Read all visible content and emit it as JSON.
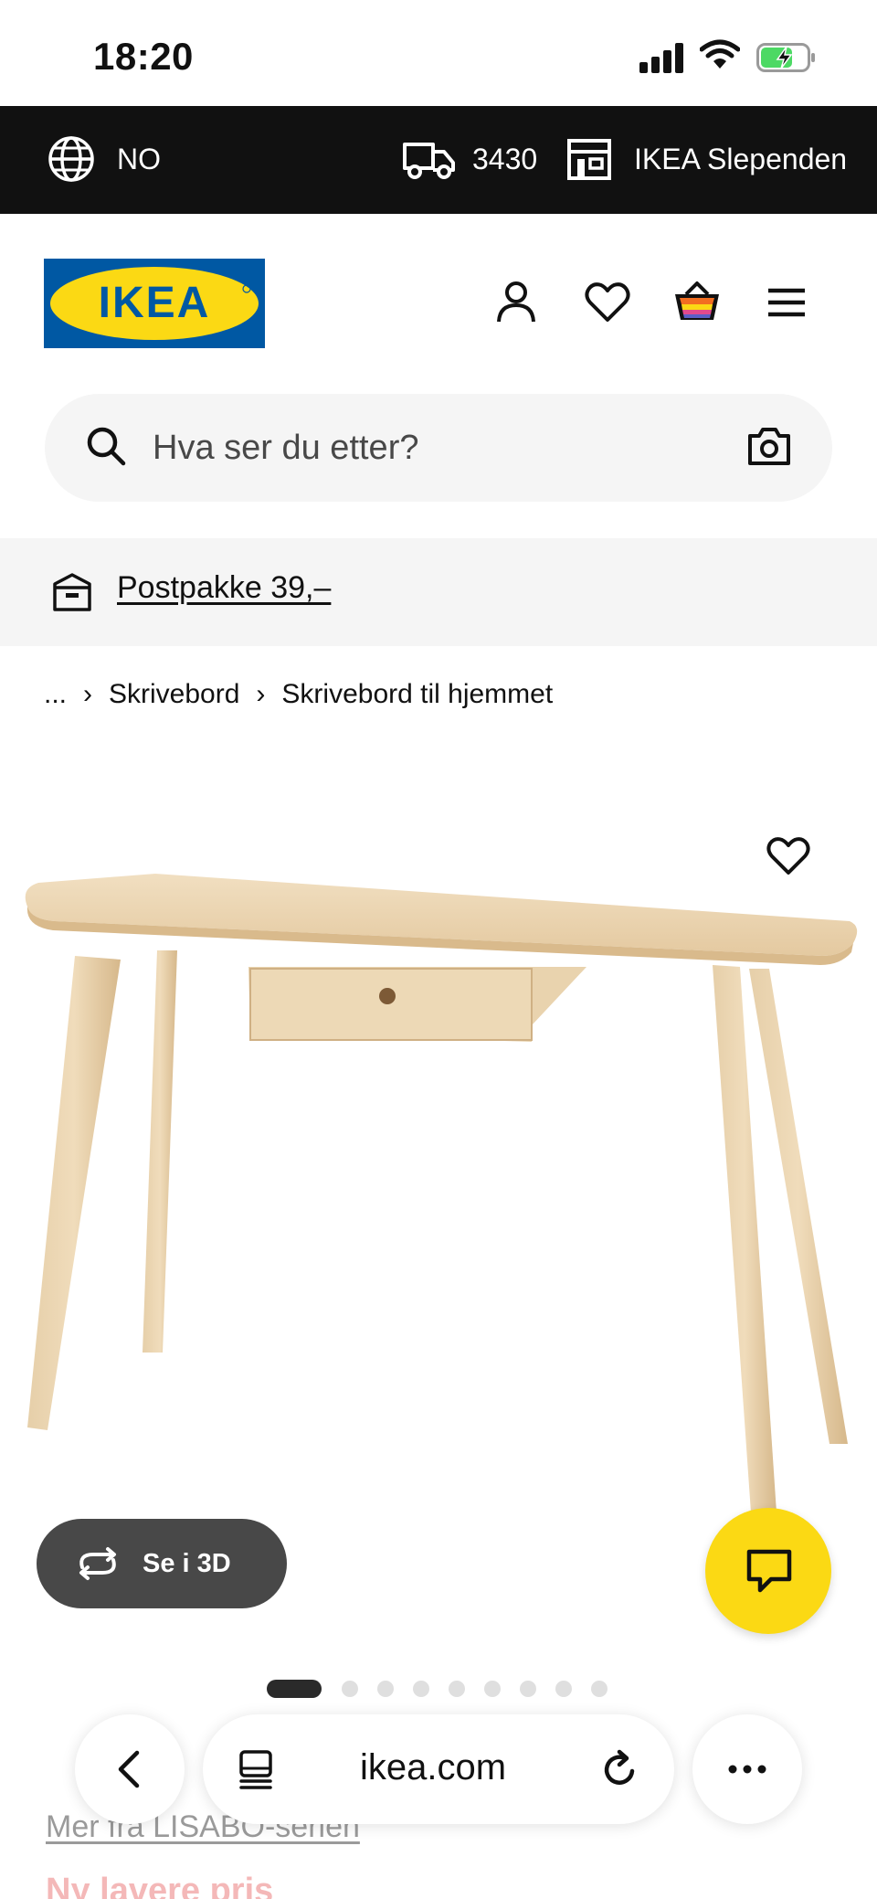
{
  "status_bar": {
    "time": "18:20"
  },
  "top_strip": {
    "language": "NO",
    "postal_code": "3430",
    "store": "IKEA Slependen"
  },
  "header": {
    "logo_text": "IKEA",
    "icons": [
      "user-icon",
      "heart-icon",
      "basket-icon",
      "menu-icon"
    ]
  },
  "search": {
    "placeholder": "Hva ser du etter?"
  },
  "promo": {
    "label": "Postpakke 39,–"
  },
  "breadcrumb": {
    "ellipsis": "...",
    "items": [
      "Skrivebord",
      "Skrivebord til hjemmet"
    ]
  },
  "product": {
    "view_3d_label": "Se i 3D",
    "image_count": 9,
    "active_image": 1
  },
  "below_fold": {
    "series_link": "Mer fra LISABO-serien",
    "price_label": "Ny lavere pris"
  },
  "browser": {
    "url": "ikea.com"
  },
  "colors": {
    "brand_yellow": "#fbd914",
    "brand_blue": "#0058a3",
    "dark": "#111111"
  }
}
